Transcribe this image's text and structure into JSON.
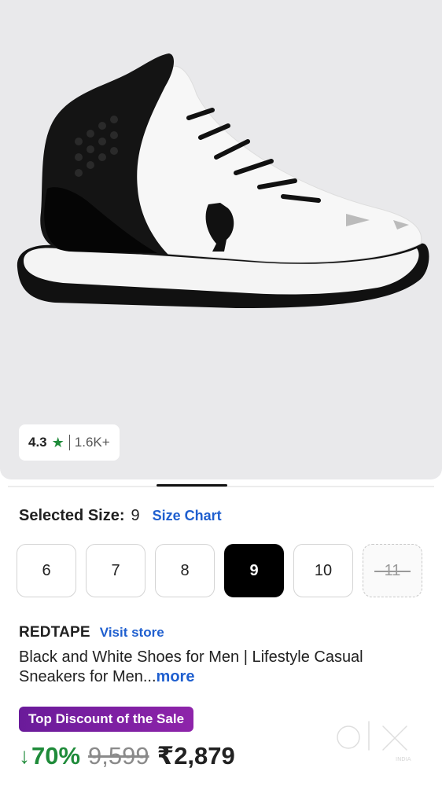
{
  "product_image": {
    "icon": "sneaker-image"
  },
  "rating": {
    "value": "4.3",
    "star_icon": "star-icon",
    "count": "1.6K+",
    "star_color": "#1f8b3a"
  },
  "size": {
    "label": "Selected Size:",
    "value": "9",
    "chart_link": "Size Chart",
    "options": [
      "6",
      "7",
      "8",
      "9",
      "10",
      "11"
    ],
    "selected": "9",
    "unavailable": [
      "11"
    ]
  },
  "brand": {
    "name": "REDTAPE",
    "visit_link": "Visit store"
  },
  "product_title": {
    "text": "Black and White Shoes for Men | Lifestyle Casual Sneakers for Men...",
    "more": "more"
  },
  "deal_badge": "Top Discount of the Sale",
  "pricing": {
    "discount": "70%",
    "mrp": "9,599",
    "price": "₹2,879",
    "arrow_icon": "arrow-down-icon"
  },
  "watermark": {
    "text": "olx",
    "subtext": "INDIA"
  },
  "colors": {
    "accent_link": "#1f5fcf",
    "discount_green": "#1f8b3a",
    "badge_purple": "#7b1fa2"
  }
}
